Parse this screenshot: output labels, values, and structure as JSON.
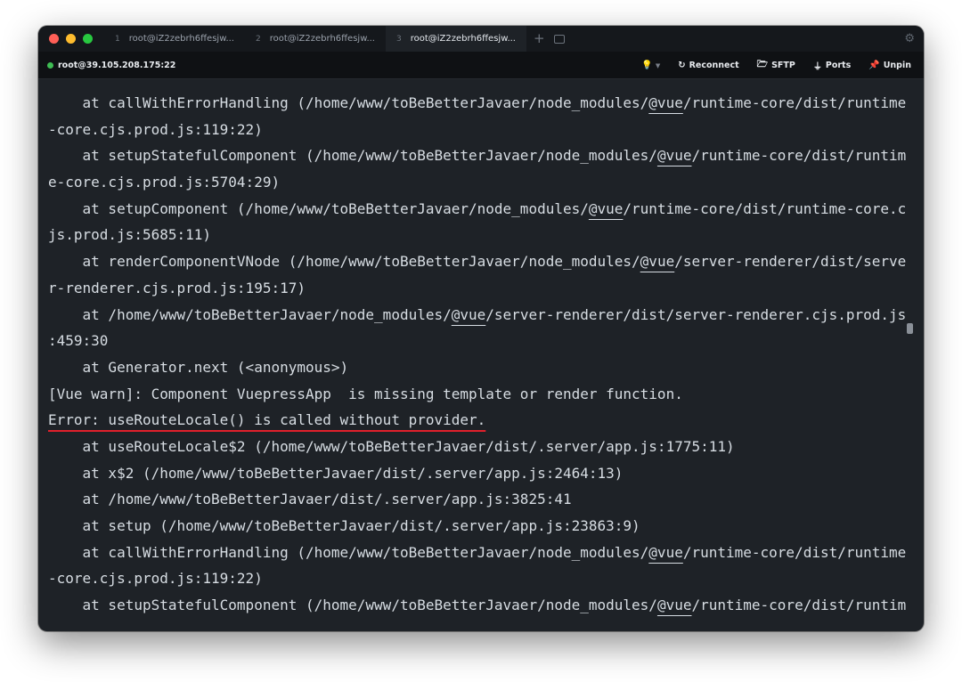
{
  "colors": {
    "close": "#ff5f57",
    "minimize": "#febc2e",
    "maximize": "#28c840",
    "online": "#3fbd54",
    "error_underline": "#e0202b"
  },
  "tabs": [
    {
      "num": "1",
      "label": "root@iZ2zebrh6ffesjw..."
    },
    {
      "num": "2",
      "label": "root@iZ2zebrh6ffesjw..."
    },
    {
      "num": "3",
      "label": "root@iZ2zebrh6ffesjw..."
    }
  ],
  "toolbar": {
    "host": "root@39.105.208.175:22",
    "reconnect": "Reconnect",
    "sftp": "SFTP",
    "ports": "Ports",
    "unpin": "Unpin"
  },
  "terminal": {
    "lines": [
      [
        "    at callWithErrorHandling (/home/www/toBeBetterJavaer/node_modules/",
        "@vue",
        "/runtime-core/dist/runtime"
      ],
      [
        "-core.cjs.prod.js:119:22)"
      ],
      [
        "    at setupStatefulComponent (/home/www/toBeBetterJavaer/node_modules/",
        "@vue",
        "/runtime-core/dist/runtim"
      ],
      [
        "e-core.cjs.prod.js:5704:29)"
      ],
      [
        "    at setupComponent (/home/www/toBeBetterJavaer/node_modules/",
        "@vue",
        "/runtime-core/dist/runtime-core.c"
      ],
      [
        "js.prod.js:5685:11)"
      ],
      [
        "    at renderComponentVNode (/home/www/toBeBetterJavaer/node_modules/",
        "@vue",
        "/server-renderer/dist/serve"
      ],
      [
        "r-renderer.cjs.prod.js:195:17)"
      ],
      [
        "    at /home/www/toBeBetterJavaer/node_modules/",
        "@vue",
        "/server-renderer/dist/server-renderer.cjs.prod.js"
      ],
      [
        ":459:30"
      ],
      [
        "    at Generator.next (<anonymous>)"
      ],
      [
        "[Vue warn]: Component VuepressApp  is missing template or render function."
      ],
      [
        "Error: useRouteLocale() is called without provider."
      ],
      [
        "    at useRouteLocale$2 (/home/www/toBeBetterJavaer/dist/.server/app.js:1775:11)"
      ],
      [
        "    at x$2 (/home/www/toBeBetterJavaer/dist/.server/app.js:2464:13)"
      ],
      [
        "    at /home/www/toBeBetterJavaer/dist/.server/app.js:3825:41"
      ],
      [
        "    at setup (/home/www/toBeBetterJavaer/dist/.server/app.js:23863:9)"
      ],
      [
        "    at callWithErrorHandling (/home/www/toBeBetterJavaer/node_modules/",
        "@vue",
        "/runtime-core/dist/runtime"
      ],
      [
        "-core.cjs.prod.js:119:22)"
      ],
      [
        "    at setupStatefulComponent (/home/www/toBeBetterJavaer/node_modules/",
        "@vue",
        "/runtime-core/dist/runtim"
      ]
    ],
    "error_line_index": 12
  }
}
